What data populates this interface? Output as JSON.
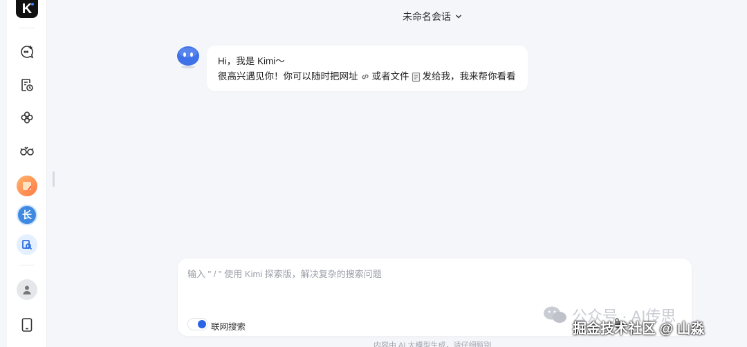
{
  "app": {
    "logo_letter": "K"
  },
  "header": {
    "title": "未命名会话"
  },
  "sidebar": {
    "items": [
      {
        "icon": "new-chat-icon"
      },
      {
        "icon": "history-icon"
      },
      {
        "icon": "explore-icon"
      },
      {
        "icon": "kimi-plus-icon"
      },
      {
        "icon": "app-orange-icon"
      },
      {
        "icon": "app-blue-icon",
        "label": "长"
      },
      {
        "icon": "app-search-icon"
      },
      {
        "icon": "user-avatar-icon"
      },
      {
        "icon": "mobile-app-icon"
      }
    ]
  },
  "message": {
    "line1": "Hi，我是 Kimi～",
    "line2_part1": "很高兴遇见你！你可以随时把网址",
    "line2_part2": "或者文件",
    "line2_part3": "发给我，我来帮你看看"
  },
  "composer": {
    "placeholder": "输入 \" / \" 使用 Kimi 探索版，解决复杂的搜索问题",
    "toggle_label": "联网搜索",
    "toggle_on": true
  },
  "footer": {
    "text": "内容由 AI 大模型生成，请仔细甄别"
  },
  "watermark": {
    "line1": "公众号 · AI传思",
    "line2": "掘金技术社区 @ 山淼"
  },
  "colors": {
    "accent": "#2b63e6",
    "background": "#f5f6fa"
  }
}
